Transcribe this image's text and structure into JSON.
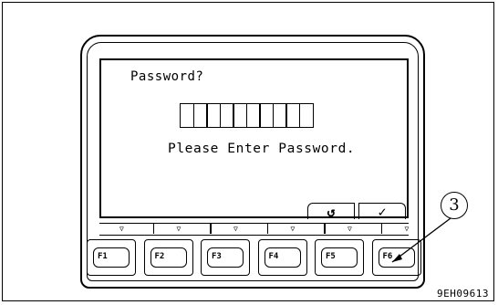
{
  "screen": {
    "prompt": "Password?",
    "password_slots": 10,
    "message": "Please Enter Password."
  },
  "soft_buttons": {
    "back_icon": "↺",
    "ok_icon": "✓"
  },
  "arrow_glyph": "▽",
  "function_keys": [
    "F1",
    "F2",
    "F3",
    "F4",
    "F5",
    "F6"
  ],
  "callout": {
    "label": "3"
  },
  "figure_id": "9EH09613"
}
